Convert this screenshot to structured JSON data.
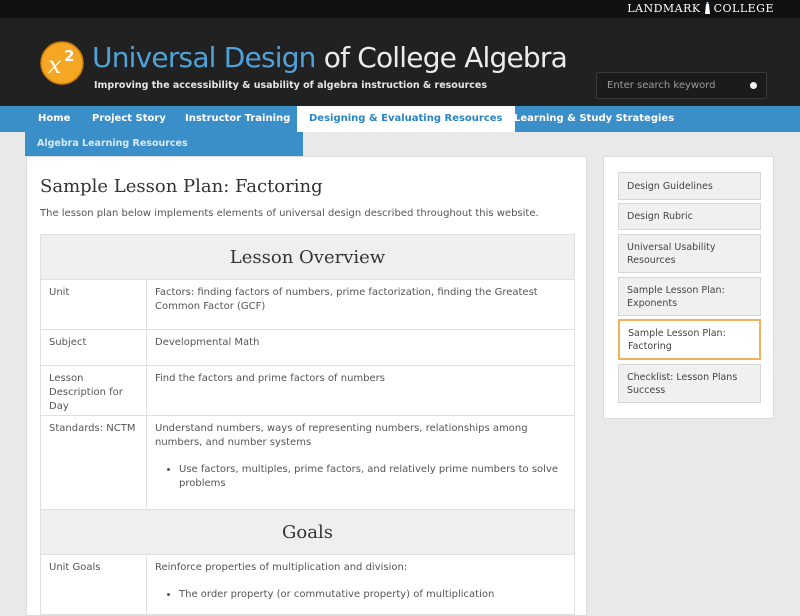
{
  "topbar": {
    "logo_left": "LANDMARK",
    "logo_right": "COLLEGE"
  },
  "header": {
    "badge_text": "x",
    "badge_exponent": "2",
    "title_part1": "Universal Design",
    "title_part2": " of College Algebra",
    "tagline": "Improving the accessibility & usability of algebra instruction & resources",
    "search_placeholder": "Enter search keyword",
    "colors": {
      "brand_blue": "#4fa2d8",
      "badge_orange": "#f5a623",
      "header_bg": "#212121"
    }
  },
  "nav": {
    "items": [
      {
        "label": "Home"
      },
      {
        "label": "Project Story"
      },
      {
        "label": "Instructor Training"
      },
      {
        "label": "Designing & Evaluating Resources",
        "active": true
      },
      {
        "label": "Learning & Study Strategies"
      }
    ],
    "dropdown_label": "Algebra Learning Resources",
    "color": "#3b8fc8"
  },
  "main": {
    "title": "Sample Lesson Plan: Factoring",
    "intro": "The lesson plan below implements elements of universal design described throughout this website.",
    "overview_heading": "Lesson Overview",
    "rows": [
      {
        "label": "Unit",
        "value": "Factors: finding factors of numbers, prime factorization, finding the Greatest Common Factor (GCF)"
      },
      {
        "label": "Subject",
        "value": "Developmental Math"
      },
      {
        "label": "Lesson Description for Day",
        "value": "Find the factors and prime factors of numbers"
      },
      {
        "label": "Standards: NCTM",
        "value": "Understand numbers, ways of representing numbers, relationships among numbers, and number systems",
        "bullet": "Use factors, multiples, prime factors, and relatively prime numbers to solve problems"
      }
    ],
    "goals_heading": "Goals",
    "goal_rows": [
      {
        "label": "Unit Goals",
        "value": "Reinforce properties of multiplication and division:",
        "bullet": "The order property (or commutative property) of multiplication"
      }
    ]
  },
  "sidebar": {
    "items": [
      {
        "label": "Design Guidelines"
      },
      {
        "label": "Design Rubric"
      },
      {
        "label": "Universal Usability Resources"
      },
      {
        "label": "Sample Lesson Plan: Exponents"
      },
      {
        "label": "Sample Lesson Plan: Factoring",
        "active": true
      },
      {
        "label": "Checklist: Lesson Plans Success"
      }
    ],
    "active_border_color": "#f0b25c"
  }
}
